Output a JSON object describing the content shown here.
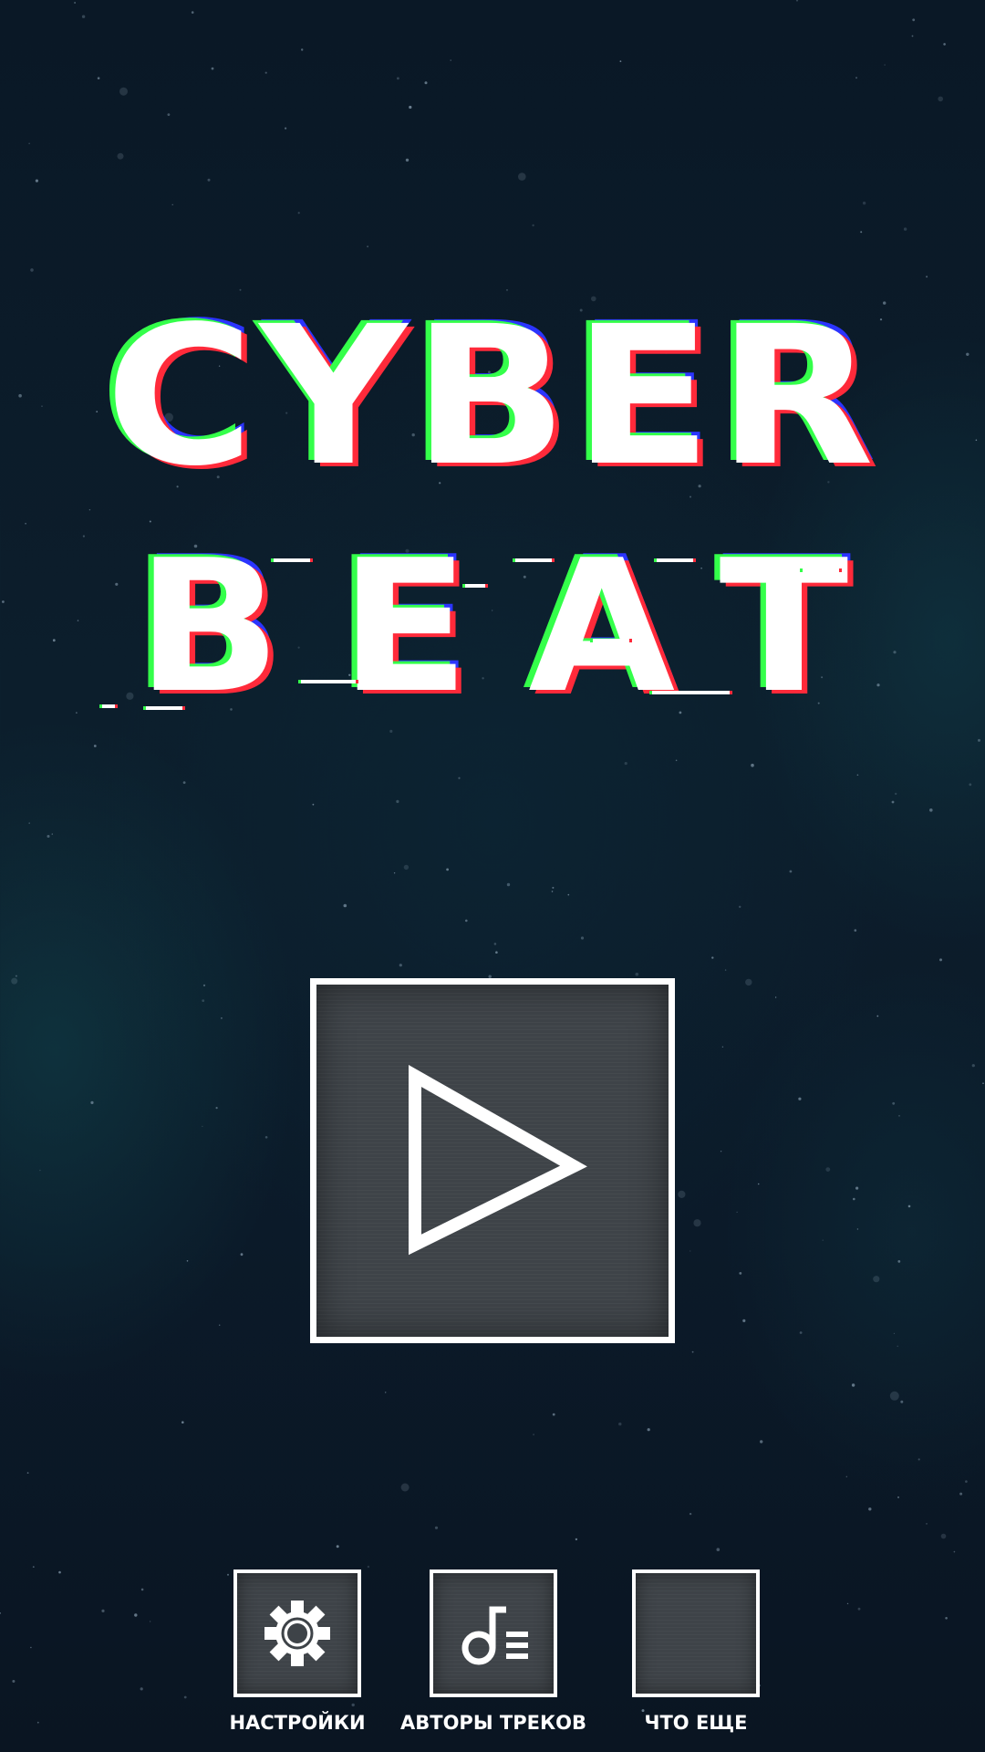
{
  "title": {
    "line1": "CYBER",
    "line2": "BEAT"
  },
  "colors": {
    "background": "#0b1a29",
    "tile": "#3e4348",
    "accent_green": "#34ff4a",
    "accent_red": "#ff2a3a",
    "accent_blue": "#2b34ff",
    "stroke": "#ffffff"
  },
  "play_button": {
    "icon": "play-icon"
  },
  "menu": [
    {
      "id": "settings",
      "label": "НАСТРОЙКИ",
      "icon": "gear-icon"
    },
    {
      "id": "track-authors",
      "label": "АВТОРЫ ТРЕКОВ",
      "icon": "music-list-icon"
    },
    {
      "id": "more",
      "label": "ЧТО ЕЩЕ",
      "icon": ""
    }
  ]
}
